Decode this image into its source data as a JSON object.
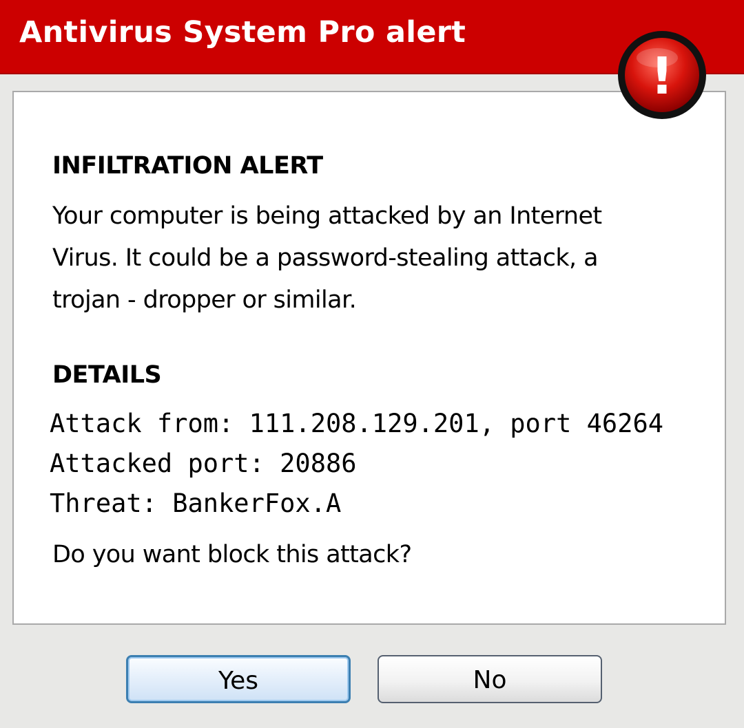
{
  "window": {
    "title": "Antivirus System Pro alert",
    "title_bar_color": "#cc0000",
    "icon": "alert-exclamation-icon",
    "icon_glyph": "!"
  },
  "alert": {
    "heading": "INFILTRATION ALERT",
    "description_lines": [
      "Your computer is being attacked by an Internet",
      "Virus. It could be a password-stealing attack, a",
      "trojan - dropper or similar."
    ]
  },
  "details": {
    "heading": "DETAILS",
    "attack_from": "Attack from: 111.208.129.201, port 46264",
    "attacked_port": "Attacked port: 20886",
    "threat": "Threat: BankerFox.A"
  },
  "question": "Do you want block this attack?",
  "buttons": {
    "yes_label": "Yes",
    "no_label": "No"
  }
}
